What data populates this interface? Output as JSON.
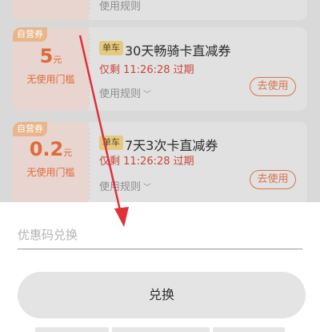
{
  "coupon_list": {
    "partial_top": {
      "rules_label": "使用规则"
    },
    "coupons": [
      {
        "tag": "自营券",
        "amount": "5",
        "unit": "元",
        "threshold": "无使用门槛",
        "biz": "单车",
        "title": "30天畅骑卡直减券",
        "expire": "仅剩 11:26:28 过期",
        "rules_label": "使用规则",
        "use_label": "去使用"
      },
      {
        "tag": "自营券",
        "amount": "0.2",
        "unit": "元",
        "threshold": "无使用门槛",
        "biz": "单车",
        "title": "7天3次卡直减券",
        "expire": "仅剩 11:26:28 过期",
        "rules_label": "使用规则",
        "use_label": "去使用"
      }
    ]
  },
  "redeem_sheet": {
    "input_placeholder": "优惠码兑换",
    "input_value": "",
    "button_label": "兑换"
  },
  "colors": {
    "accent": "#df6a3a",
    "annotation_arrow": "#e0303a"
  },
  "icons": {
    "rules_chevron": "chevron-down-icon",
    "annotation": "red-arrow-annotation"
  }
}
